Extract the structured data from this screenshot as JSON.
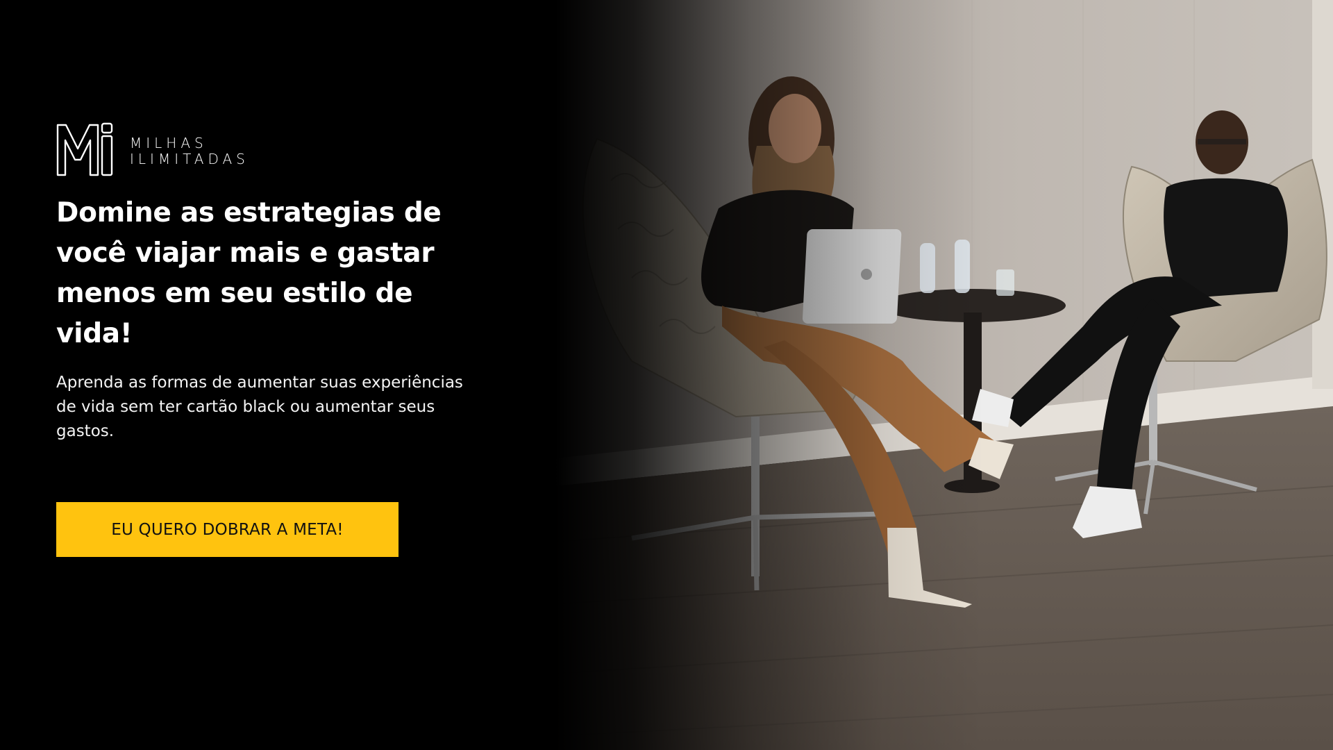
{
  "brand": {
    "logo_icon": "mi-monogram-icon",
    "name_line1": "MILHAS",
    "name_line2": "ILIMITADAS"
  },
  "hero": {
    "headline": "Domine as estrategias de você viajar mais e gastar menos em seu estilo de vida!",
    "subtext": "Aprenda as formas de aumentar suas experiências de vida sem ter cartão black ou aumentar seus gastos.",
    "cta_label": "EU QUERO DOBRAR A META!"
  },
  "colors": {
    "background": "#000000",
    "accent": "#FFC30F",
    "text": "#FFFFFF",
    "cta_text": "#111111"
  }
}
